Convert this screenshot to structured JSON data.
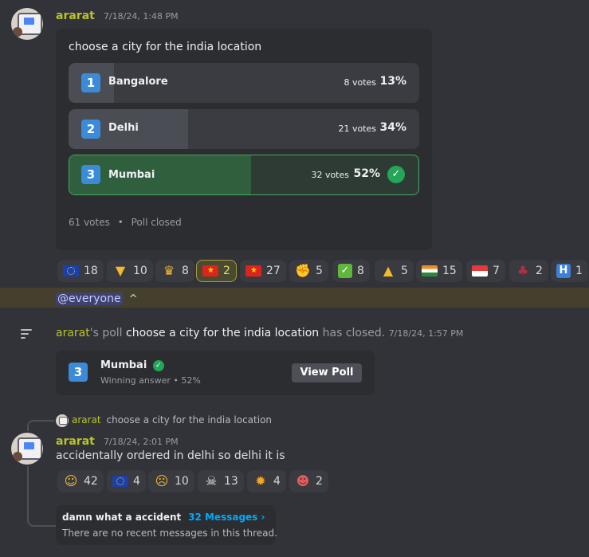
{
  "message1": {
    "username": "ararat",
    "timestamp": "7/18/24, 1:48 PM"
  },
  "poll": {
    "question": "choose a city for the india location",
    "options": [
      {
        "num": "1",
        "label": "Bangalore",
        "votes": "8 votes",
        "percent": "13%",
        "fraction": 0.13
      },
      {
        "num": "2",
        "label": "Delhi",
        "votes": "21 votes",
        "percent": "34%",
        "fraction": 0.34
      },
      {
        "num": "3",
        "label": "Mumbai",
        "votes": "32 votes",
        "percent": "52%",
        "fraction": 0.52
      }
    ],
    "total_votes": "61 votes",
    "separator": "•",
    "status": "Poll closed"
  },
  "reactions1": [
    {
      "icon": "eu-flag-icon",
      "count": "18"
    },
    {
      "icon": "thumbs-down-icon",
      "count": "10"
    },
    {
      "icon": "crown-face-icon",
      "count": "8"
    },
    {
      "icon": "vietnam-flag-icon",
      "count": "2",
      "active": true
    },
    {
      "icon": "vietnam-flag-icon",
      "count": "27"
    },
    {
      "icon": "pinching-hand-icon",
      "count": "5"
    },
    {
      "icon": "check-box-icon",
      "count": "8"
    },
    {
      "icon": "thumbs-up-icon",
      "count": "5"
    },
    {
      "icon": "india-flag-icon",
      "count": "15"
    },
    {
      "icon": "singapore-flag-icon",
      "count": "7"
    },
    {
      "icon": "anime-girl-icon",
      "count": "2"
    },
    {
      "icon": "hospital-h-icon",
      "count": "1"
    }
  ],
  "everyone": {
    "mention": "@everyone",
    "suffix": "^"
  },
  "system": {
    "username": "ararat",
    "poll_word": "'s poll",
    "poll_title": "choose a city for the india location",
    "closed_text": "has closed.",
    "timestamp": "7/18/24, 1:57 PM",
    "result_num": "3",
    "result_label": "Mumbai",
    "result_sub": "Winning answer • 52%",
    "view_button": "View Poll"
  },
  "reply": {
    "ref_username": "ararat",
    "ref_text": "choose a city for the india location"
  },
  "message2": {
    "username": "ararat",
    "timestamp": "7/18/24, 2:01 PM",
    "text": "accidentally ordered in delhi so delhi it is"
  },
  "reactions2": [
    {
      "icon": "rofl-icon",
      "count": "42"
    },
    {
      "icon": "eu-flag-icon",
      "count": "4"
    },
    {
      "icon": "tired-face-icon",
      "count": "10"
    },
    {
      "icon": "skull-icon",
      "count": "13"
    },
    {
      "icon": "sun-icon",
      "count": "4"
    },
    {
      "icon": "clown-face-icon",
      "count": "2"
    }
  ],
  "thread": {
    "title": "damn what a accident",
    "count": "32 Messages ›",
    "empty": "There are no recent messages in this thread."
  },
  "colors": {
    "background": "#323339",
    "username": "#b8c32a",
    "winner_green": "#23a55a",
    "link_blue": "#00a8fc"
  }
}
